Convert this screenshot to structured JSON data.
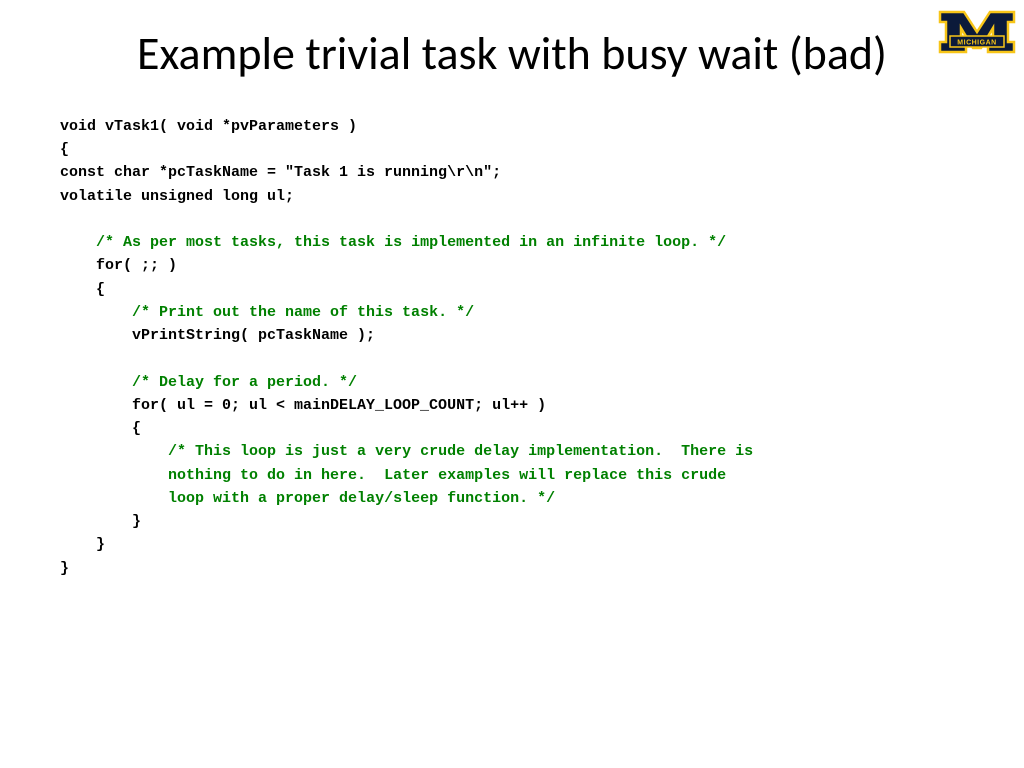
{
  "title": "Example trivial task with busy wait (bad)",
  "logo_text": "MICHIGAN",
  "code": {
    "lines": [
      {
        "indent": 0,
        "type": "code",
        "text": "void vTask1( void *pvParameters )"
      },
      {
        "indent": 0,
        "type": "code",
        "text": "{"
      },
      {
        "indent": 0,
        "type": "code",
        "text": "const char *pcTaskName = \"Task 1 is running\\r\\n\";"
      },
      {
        "indent": 0,
        "type": "code",
        "text": "volatile unsigned long ul;"
      },
      {
        "indent": 0,
        "type": "blank",
        "text": ""
      },
      {
        "indent": 1,
        "type": "comment",
        "text": "/* As per most tasks, this task is implemented in an infinite loop. */"
      },
      {
        "indent": 1,
        "type": "code",
        "text": "for( ;; )"
      },
      {
        "indent": 1,
        "type": "code",
        "text": "{"
      },
      {
        "indent": 2,
        "type": "comment",
        "text": "/* Print out the name of this task. */"
      },
      {
        "indent": 2,
        "type": "code",
        "text": "vPrintString( pcTaskName );"
      },
      {
        "indent": 0,
        "type": "blank",
        "text": ""
      },
      {
        "indent": 2,
        "type": "comment",
        "text": "/* Delay for a period. */"
      },
      {
        "indent": 2,
        "type": "code",
        "text": "for( ul = 0; ul < mainDELAY_LOOP_COUNT; ul++ )"
      },
      {
        "indent": 2,
        "type": "code",
        "text": "{"
      },
      {
        "indent": 3,
        "type": "comment",
        "text": "/* This loop is just a very crude delay implementation.  There is"
      },
      {
        "indent": 3,
        "type": "comment",
        "text": "nothing to do in here.  Later examples will replace this crude"
      },
      {
        "indent": 3,
        "type": "comment",
        "text": "loop with a proper delay/sleep function. */"
      },
      {
        "indent": 2,
        "type": "code",
        "text": "}"
      },
      {
        "indent": 1,
        "type": "code",
        "text": "}"
      },
      {
        "indent": 0,
        "type": "code",
        "text": "}"
      }
    ],
    "indent_unit": "    "
  }
}
